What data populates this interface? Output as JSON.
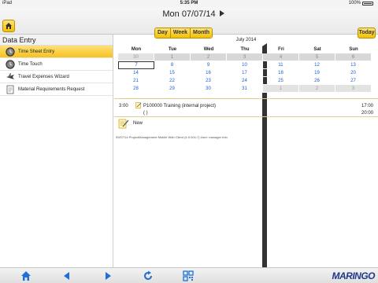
{
  "status": {
    "carrier": "iPad",
    "time": "5:35 PM",
    "battery": "100%"
  },
  "nav": {
    "title": "Mon 07/07/14",
    "views": [
      "Day",
      "Week",
      "Month"
    ],
    "today": "Today"
  },
  "sidebar": {
    "title": "Data Entry",
    "items": [
      {
        "label": "Time Sheet Entry",
        "icon": "clock-icon",
        "selected": true
      },
      {
        "label": "Time Touch",
        "icon": "clock-icon",
        "selected": false
      },
      {
        "label": "Travel Expenses Wizard",
        "icon": "plane-icon",
        "selected": false
      },
      {
        "label": "Material Requirements Request",
        "icon": "document-icon",
        "selected": false
      }
    ]
  },
  "calendar": {
    "title": "July 2014",
    "weekdays": [
      "Mon",
      "Tue",
      "Wed",
      "Thu",
      "Fri",
      "Sat",
      "Sun"
    ],
    "weeks": [
      [
        "30",
        "1",
        "2",
        "3",
        "4",
        "5",
        "6"
      ],
      [
        "7",
        "8",
        "9",
        "10",
        "11",
        "12",
        "13"
      ],
      [
        "14",
        "15",
        "16",
        "17",
        "18",
        "19",
        "20"
      ],
      [
        "21",
        "22",
        "23",
        "24",
        "25",
        "26",
        "27"
      ],
      [
        "28",
        "29",
        "30",
        "31",
        "1",
        "2",
        "3"
      ]
    ],
    "selected_day": "7"
  },
  "entry": {
    "start": "3:00",
    "description": "P100000 Training (internal project)",
    "sub": "( )",
    "end1": "17:00",
    "end2": "20:00"
  },
  "new_label": "New",
  "version": "09/07/14 ProjectManagement Mobile Web Client (4.9.004.7) User: manager Info",
  "brand": "MARINGO",
  "colors": {
    "accent": "#f3c000",
    "link": "#1a5fd0",
    "toolbar_icon": "#1f6fd6"
  }
}
